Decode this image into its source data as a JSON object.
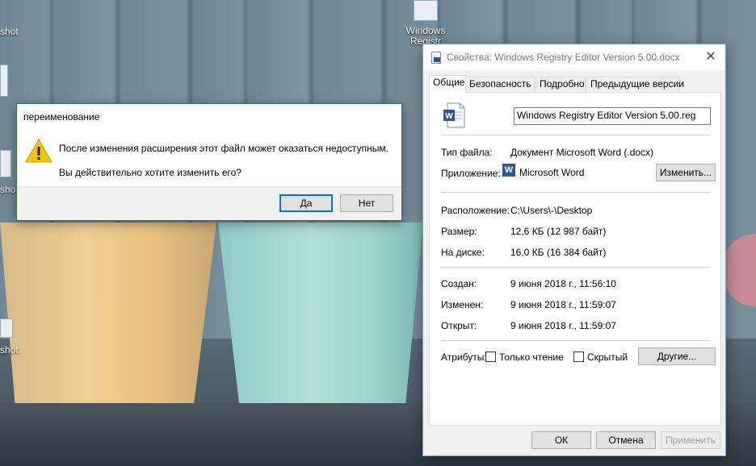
{
  "desktop": {
    "icons": [
      {
        "label": "shot..."
      },
      {
        "label": ""
      },
      {
        "label": "shot..."
      },
      {
        "label": "shot..."
      },
      {
        "label": "Windows Registr..."
      }
    ],
    "icon_labels_visible": {
      "i1": "shot",
      "i3": "shot",
      "i4": "shot",
      "i5a": "Windows",
      "i5b": "Registr"
    }
  },
  "rename_dialog": {
    "title": "переименование",
    "icon": "warning-icon",
    "message_line1": "После изменения расширения этот файл может оказаться недоступным.",
    "message_line2": "Вы действительно хотите изменить его?",
    "yes_label": "Да",
    "no_label": "Нет"
  },
  "properties": {
    "title": "Свойства: Windows Registry Editor Version 5.00.docx",
    "close_glyph": "✕",
    "tabs": [
      {
        "label": "Общие",
        "active": true
      },
      {
        "label": "Безопасность",
        "active": false
      },
      {
        "label": "Подробно",
        "active": false
      },
      {
        "label": "Предыдущие версии",
        "active": false
      }
    ],
    "file_name": "Windows Registry Editor Version 5.00.reg",
    "file_type_label": "Тип файла:",
    "file_type_value": "Документ Microsoft Word (.docx)",
    "app_label": "Приложение:",
    "app_value": "Microsoft Word",
    "app_icon_letter": "W",
    "change_button": "Изменить...",
    "location_label": "Расположение:",
    "location_value": "C:\\Users\\-\\Desktop",
    "size_label": "Размер:",
    "size_value": "12,6 КБ (12 987 байт)",
    "disk_label": "На диске:",
    "disk_value": "16,0 КБ (16 384 байт)",
    "created_label": "Создан:",
    "created_value": "9 июня 2018 г., 11:56:10",
    "modified_label": "Изменен:",
    "modified_value": "9 июня 2018 г., 11:59:07",
    "opened_label": "Открыт:",
    "opened_value": "9 июня 2018 г., 11:59:07",
    "attributes_label": "Атрибуты:",
    "readonly_label": "Только чтение",
    "hidden_label": "Скрытый",
    "other_button": "Другие...",
    "ok_button": "ОК",
    "cancel_button": "Отмена",
    "apply_button": "Применить"
  }
}
